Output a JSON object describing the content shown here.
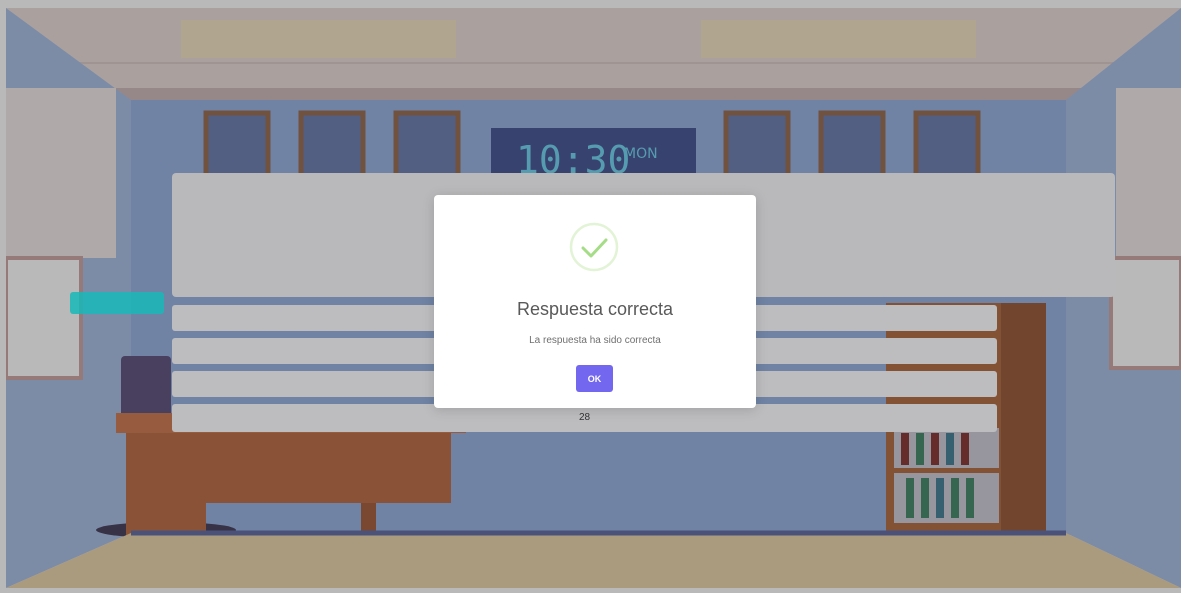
{
  "game_screen": {
    "clock": {
      "time": "10:30",
      "day": "MON"
    },
    "side_button_label": "",
    "answer_rows": [
      "",
      "",
      "",
      "",
      "28"
    ]
  },
  "dialog": {
    "title": "Respuesta correcta",
    "message": "La respuesta ha sido correcta",
    "ok_label": "OK",
    "icon": "success-check-icon"
  },
  "colors": {
    "accent": "#7367f0",
    "success": "#a5dc86",
    "side_button": "#17b8b8",
    "wall": "#8ea9df"
  }
}
